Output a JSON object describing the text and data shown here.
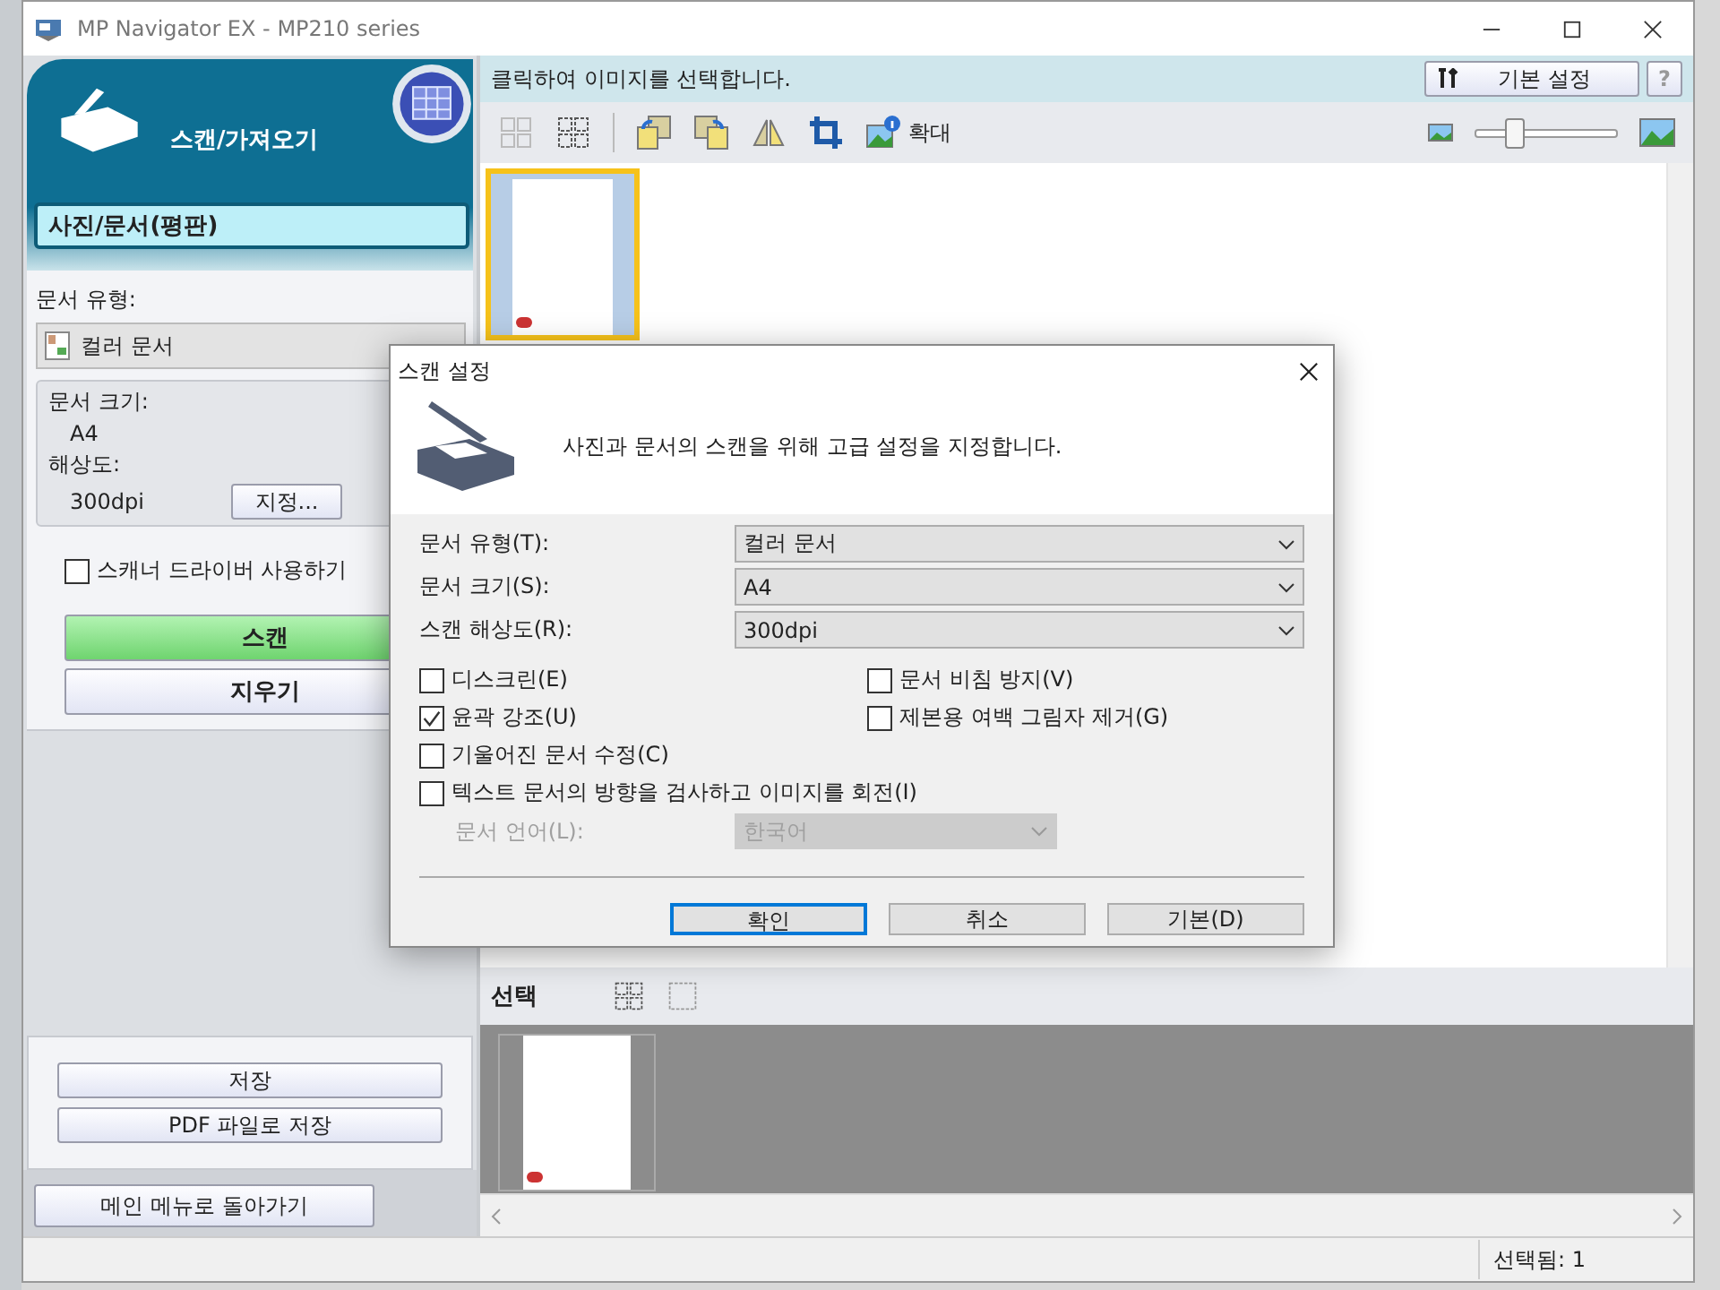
{
  "window": {
    "title": "MP Navigator EX - MP210 series"
  },
  "left_panel": {
    "mode_title": "스캔/가져오기",
    "source": "사진/문서(평판)",
    "doc_type_label": "문서 유형:",
    "doc_type_value": "컬러 문서",
    "summary": [
      {
        "label": "문서 크기:",
        "value": "A4"
      },
      {
        "label": "해상도:",
        "value": "300dpi"
      }
    ],
    "specify_button": "지정...",
    "scanner_driver": {
      "label": "스캐너 드라이버 사용하기",
      "checked": false
    },
    "scan_button": "스캔",
    "clear_button": "지우기",
    "save_buttons": [
      "저장",
      "PDF 파일로 저장"
    ],
    "main_menu_button": "메인 메뉴로 돌아가기"
  },
  "main": {
    "header_text": "클릭하여 이미지를 선택합니다.",
    "settings_button": "기본 설정",
    "help_button": "?",
    "zoom_label": "확대",
    "thumbnail_size": {
      "level": 0.28
    },
    "thumbnails": [
      {
        "selected": true
      }
    ],
    "selection_label": "선택",
    "tray": [
      {
        "selected": false
      }
    ]
  },
  "status_bar": {
    "text": "선택됨: 1"
  },
  "dialog": {
    "title": "스캔 설정",
    "description": "사진과 문서의 스캔을 위해 고급 설정을 지정합니다.",
    "fields": [
      {
        "label": "문서 유형(T):",
        "value": "컬러 문서"
      },
      {
        "label": "문서 크기(S):",
        "value": "A4"
      },
      {
        "label": "스캔 해상도(R):",
        "value": "300dpi"
      }
    ],
    "options_grid": [
      {
        "label": "디스크린(E)",
        "checked": false
      },
      {
        "label": "문서 비침 방지(V)",
        "checked": false
      },
      {
        "label": "윤곽 강조(U)",
        "checked": true
      },
      {
        "label": "제본용 여백 그림자 제거(G)",
        "checked": false
      }
    ],
    "options": [
      {
        "label": "기울어진 문서 수정(C)",
        "checked": false
      },
      {
        "label": "텍스트 문서의 방향을 검사하고 이미지를 회전(I)",
        "checked": false
      }
    ],
    "language": {
      "label": "문서 언어(L):",
      "value": "한국어",
      "disabled": true
    },
    "buttons": [
      {
        "label": "확인",
        "default": true
      },
      {
        "label": "취소",
        "default": false
      },
      {
        "label": "기본(D)",
        "default": false
      }
    ]
  }
}
